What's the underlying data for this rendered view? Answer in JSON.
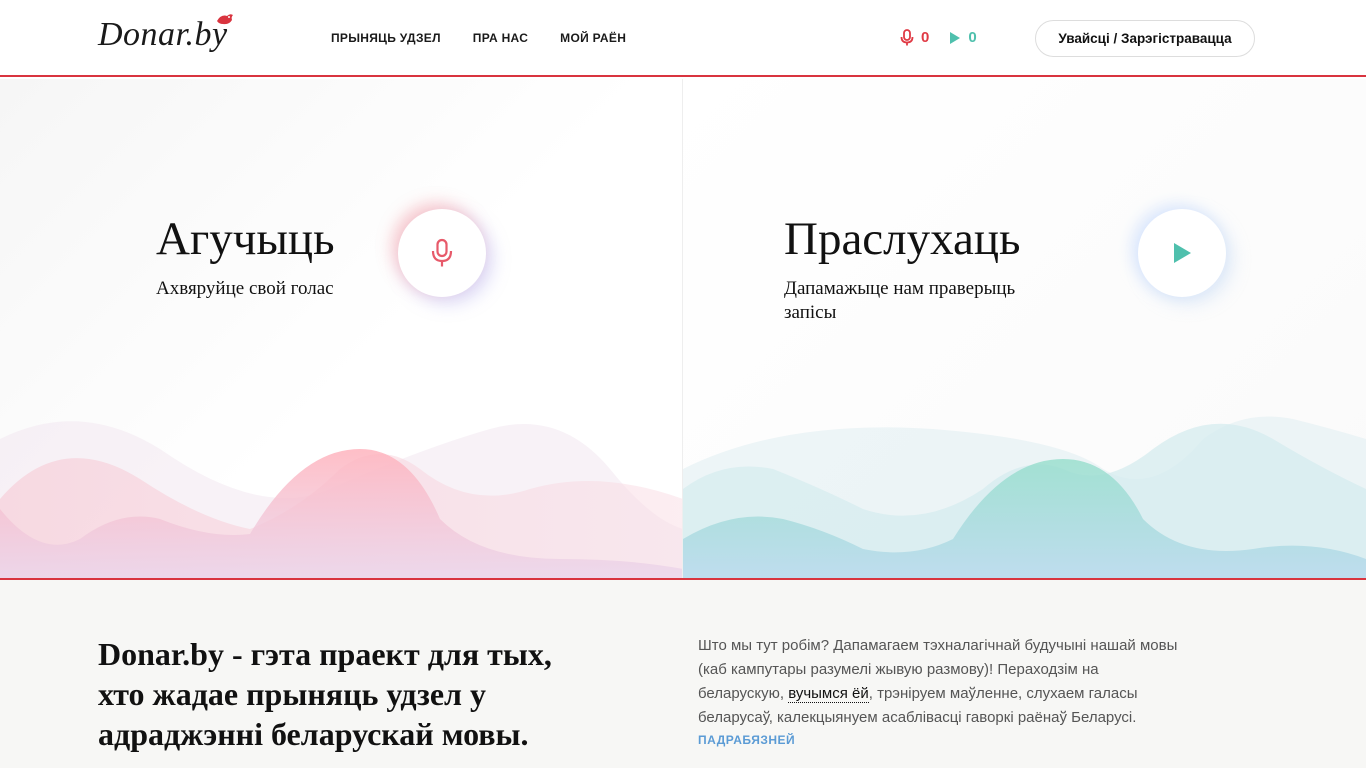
{
  "header": {
    "logo": "Donar.by",
    "nav": [
      "ПРЫНЯЦЬ УДЗЕЛ",
      "ПРА НАС",
      "МОЙ РАЁН"
    ],
    "counters": {
      "recorded": "0",
      "listened": "0"
    },
    "login_label": "Увайсці / Зарэгістравацца"
  },
  "hero": {
    "record": {
      "title": "Агучыць",
      "subtitle": "Ахвяруйце свой голас",
      "icon": "microphone-icon"
    },
    "listen": {
      "title": "Праслухаць",
      "subtitle_line1": "Дапамажыце нам праверыць",
      "subtitle_line2": "запісы",
      "icon": "play-icon"
    }
  },
  "about": {
    "title": "Donar.by - гэта праект для тых, хто жадае прыняць удзел у адраджэнні беларускай мовы.",
    "text_before": "Што мы тут робім? Дапамагаем тэхналагічнай будучыні нашай мовы (каб кампутары разумелі жывую размову)! Пераходзім на беларускую, ",
    "text_link": "вучымся ёй",
    "text_after": ", трэніруем маўленне, слухаем галасы беларусаў, калекцыянуем асаблівасці гаворкі раёнаў Беларусі.",
    "more_label": "ПАДРАБЯЗНЕЙ"
  },
  "colors": {
    "accent_red": "#d9343f",
    "accent_teal": "#4fc0ad",
    "link_blue": "#5b9bd5"
  }
}
